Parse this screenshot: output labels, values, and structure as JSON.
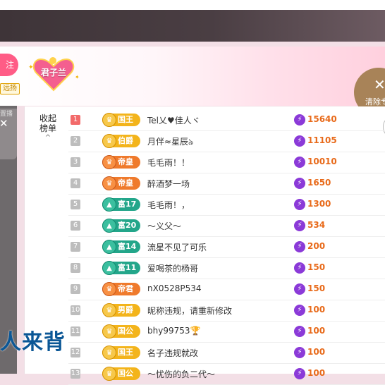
{
  "header": {
    "pill_text": "注",
    "small_tag": "远扬",
    "heart_badge": "君子兰",
    "clear_button": {
      "icon": "close-icon",
      "label": "清除专"
    }
  },
  "left_panel": {
    "caption": "置播",
    "close_icon": "close-icon"
  },
  "overlay_text": "人来背",
  "panel": {
    "collapse_label_line1": "收起",
    "collapse_label_line2": "榜单",
    "collapse_chevron": "^"
  },
  "colors": {
    "gold": "#f3b41b",
    "orange": "#ef7a2c",
    "green": "#23a68a",
    "bolt": "#8b3ad8",
    "value": "#e86a1a",
    "rank_top": "#f26a6a"
  },
  "rows": [
    {
      "rank": "1",
      "badge": "国王",
      "badge_style": "gold",
      "badge_icon": "crown-icon",
      "name": "Tel乂♥佳人ヾ",
      "value": "15640"
    },
    {
      "rank": "2",
      "badge": "伯爵",
      "badge_style": "gold",
      "badge_icon": "crown-icon",
      "name": "月伴≈星辰ঌ",
      "value": "11105"
    },
    {
      "rank": "3",
      "badge": "帝皇",
      "badge_style": "orange",
      "badge_icon": "crown-icon",
      "name": "毛毛雨！！",
      "value": "10010"
    },
    {
      "rank": "4",
      "badge": "帝皇",
      "badge_style": "orange",
      "badge_icon": "crown-icon",
      "name": "醉酒梦一场",
      "value": "1650"
    },
    {
      "rank": "5",
      "badge": "富17",
      "badge_style": "green",
      "badge_icon": "mountain-icon",
      "name": "毛毛雨！，",
      "value": "1300"
    },
    {
      "rank": "6",
      "badge": "富20",
      "badge_style": "green",
      "badge_icon": "mountain-icon",
      "name": "～义父～",
      "value": "534"
    },
    {
      "rank": "7",
      "badge": "富14",
      "badge_style": "green",
      "badge_icon": "mountain-icon",
      "name": "流星不见了可乐",
      "value": "200"
    },
    {
      "rank": "8",
      "badge": "富11",
      "badge_style": "green",
      "badge_icon": "mountain-icon",
      "name": "爱喝茶的杨哥",
      "value": "150"
    },
    {
      "rank": "9",
      "badge": "帝君",
      "badge_style": "orange",
      "badge_icon": "crown-icon",
      "name": "nX0528P534",
      "value": "150"
    },
    {
      "rank": "10",
      "badge": "男爵",
      "badge_style": "gold",
      "badge_icon": "crown-icon",
      "name": "昵称违规，请重新修改",
      "value": "100"
    },
    {
      "rank": "11",
      "badge": "国公",
      "badge_style": "gold",
      "badge_icon": "crown-icon",
      "name": "bhy99753🏆",
      "value": "100"
    },
    {
      "rank": "12",
      "badge": "国王",
      "badge_style": "gold",
      "badge_icon": "crown-icon",
      "name": "名子违规就改",
      "value": "100"
    },
    {
      "rank": "13",
      "badge": "国公",
      "badge_style": "gold",
      "badge_icon": "crown-icon",
      "name": "～忧伤的负二代～",
      "value": "100"
    }
  ]
}
